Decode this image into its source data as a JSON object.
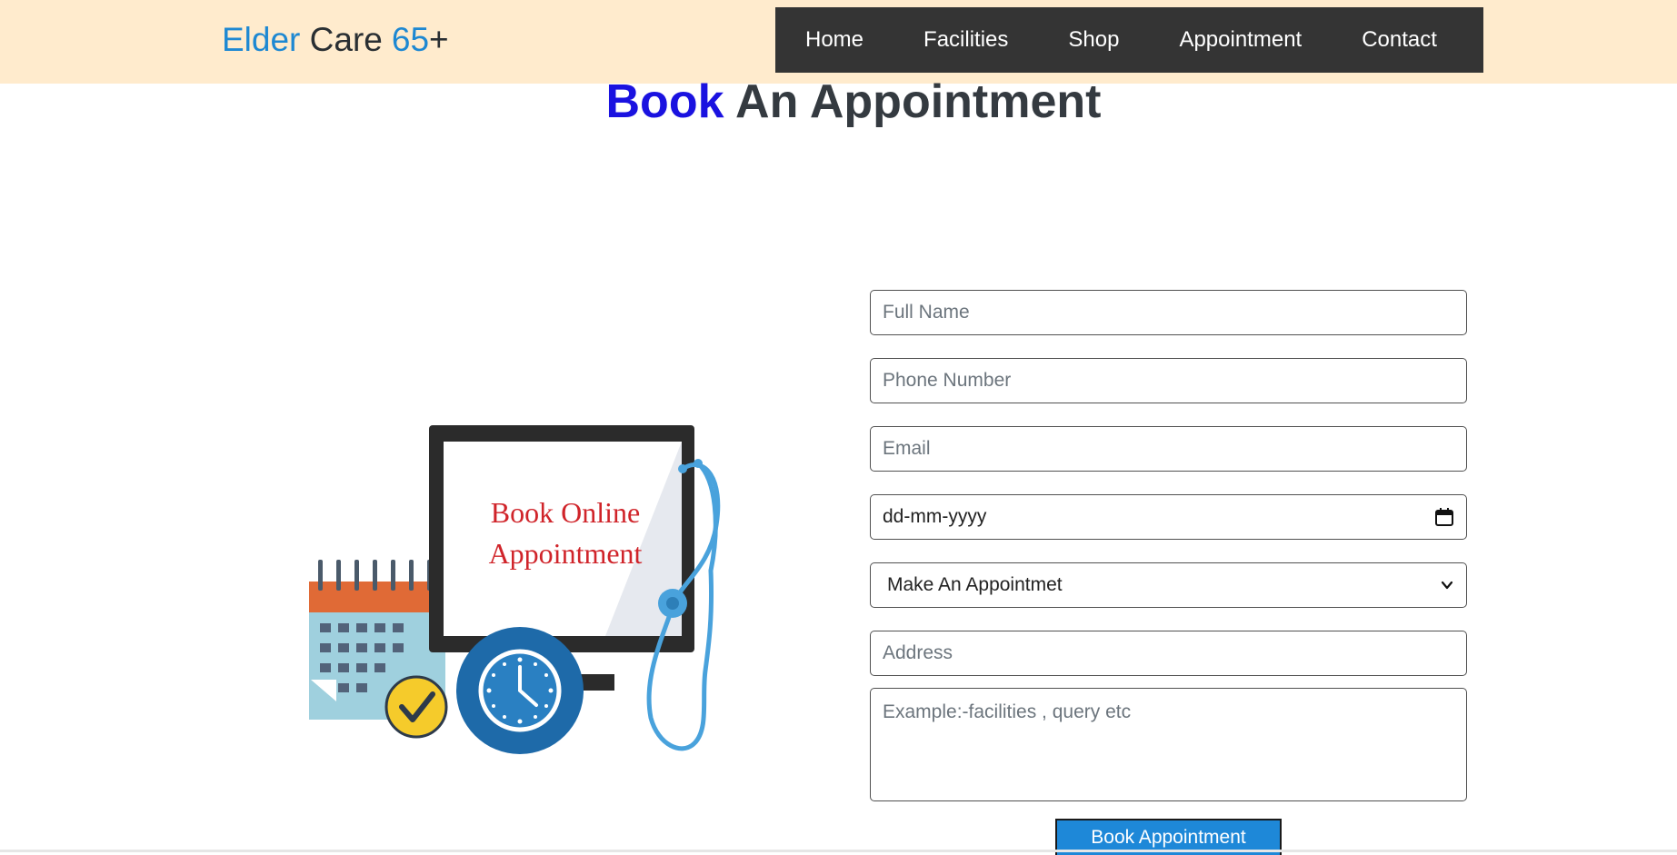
{
  "brand": {
    "part1": "Elder",
    "part2": "Care",
    "part3": "65",
    "part4": "+"
  },
  "nav": {
    "items": [
      "Home",
      "Facilities",
      "Shop",
      "Appointment",
      "Contact"
    ]
  },
  "page": {
    "title_accent": "Book",
    "title_rest": "An Appointment"
  },
  "illustration": {
    "line1": "Book Online",
    "line2": "Appointment"
  },
  "form": {
    "full_name_placeholder": "Full Name",
    "phone_placeholder": "Phone Number",
    "email_placeholder": "Email",
    "date_placeholder": "dd-mm-yyyy",
    "select_value": "Make An Appointmet",
    "address_placeholder": "Address",
    "message_placeholder": "Example:-facilities , query etc",
    "submit_label": "Book Appointment"
  },
  "colors": {
    "header_bg": "#ffebcd",
    "nav_bg": "#343434",
    "brand_blue": "#1e88d2",
    "title_accent": "#1a12e0",
    "button_bg": "#1e88d8"
  },
  "icons": {
    "date_picker": "calendar-icon",
    "select": "chevron-down-icon"
  }
}
